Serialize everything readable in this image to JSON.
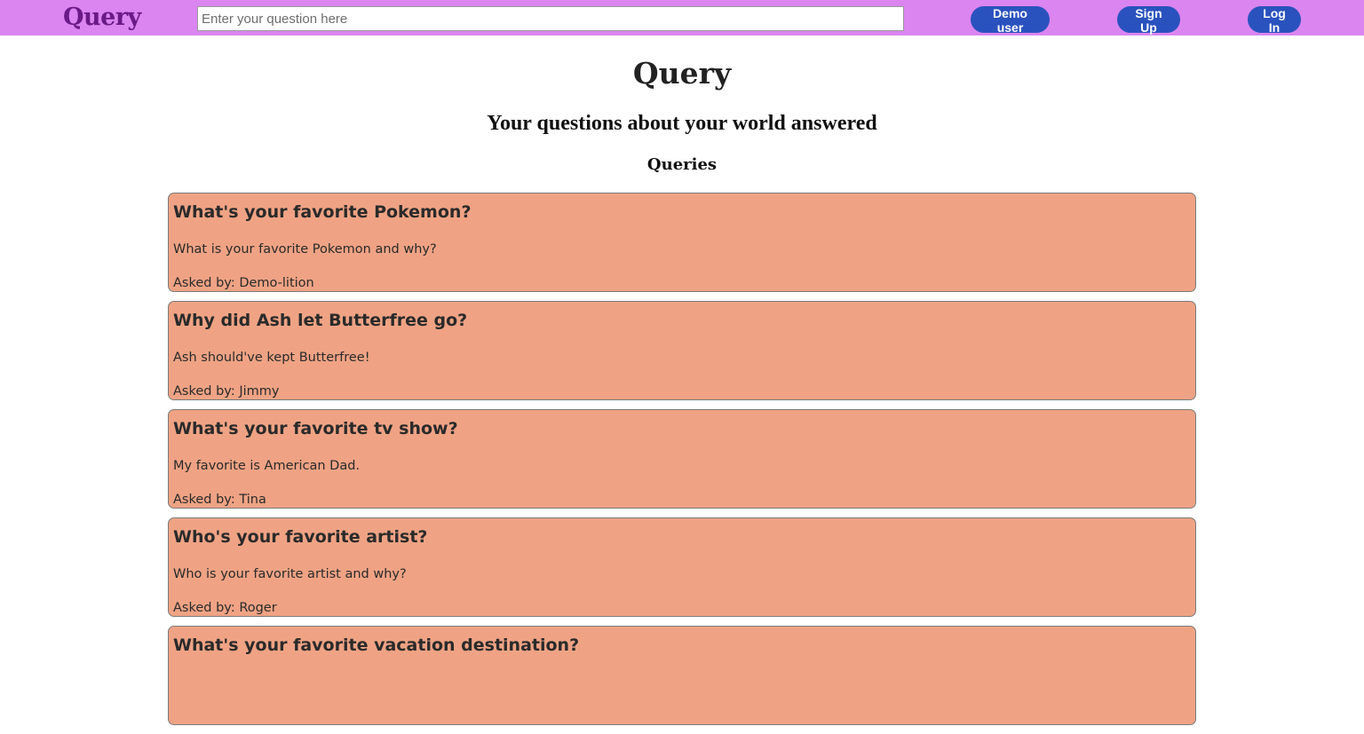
{
  "navbar": {
    "logo": "Query",
    "search": {
      "placeholder": "Enter your question here",
      "value": ""
    },
    "buttons": {
      "demo": "Demo user",
      "signup": "Sign Up",
      "login": "Log In"
    }
  },
  "hero": {
    "title": "Query",
    "subtitle": "Your questions about your world answered"
  },
  "section": {
    "title": "Queries"
  },
  "queries": [
    {
      "title": "What's your favorite Pokemon?",
      "body": "What is your favorite Pokemon and why?",
      "author": "Asked by: Demo-lition"
    },
    {
      "title": "Why did Ash let Butterfree go?",
      "body": "Ash should've kept Butterfree!",
      "author": "Asked by: Jimmy"
    },
    {
      "title": "What's your favorite tv show?",
      "body": "My favorite is American Dad.",
      "author": "Asked by: Tina"
    },
    {
      "title": "Who's your favorite artist?",
      "body": "Who is your favorite artist and why?",
      "author": "Asked by: Roger"
    },
    {
      "title": "What's your favorite vacation destination?",
      "body": "",
      "author": ""
    }
  ],
  "colors": {
    "navbar_bg": "#da85f0",
    "logo": "#6a1a86",
    "button_bg": "#2a52be",
    "card_bg": "#efa384"
  }
}
